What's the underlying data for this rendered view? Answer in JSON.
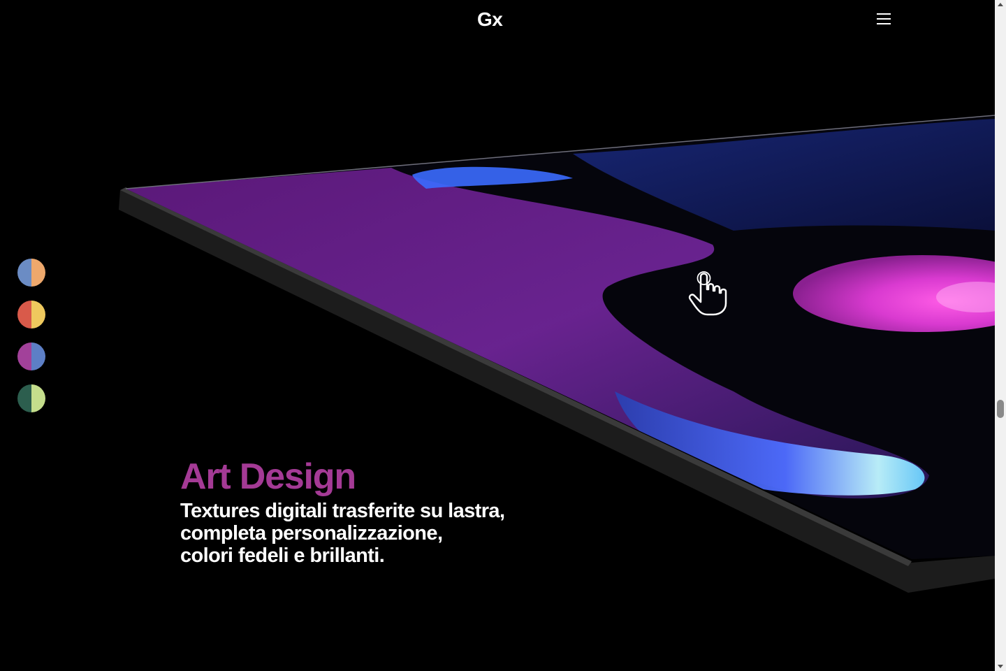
{
  "header": {
    "logo_text": "Gx",
    "menu_icon": "hamburger-menu-icon"
  },
  "swatches": [
    {
      "name": "blue-orange",
      "left_color": "#6b8cc4",
      "right_color": "#eea86c"
    },
    {
      "name": "red-yellow",
      "left_color": "#d95a4a",
      "right_color": "#efc95e"
    },
    {
      "name": "magenta-blue",
      "left_color": "#a2419a",
      "right_color": "#5d7fc6"
    },
    {
      "name": "green-lime",
      "left_color": "#2c5e4e",
      "right_color": "#c5de8c"
    }
  ],
  "hero": {
    "title": "Art Design",
    "title_color": "#a43a95",
    "subtitle_lines": [
      "Textures digitali trasferite su lastra,",
      "completa personalizzazione,",
      "colori fedeli e brillanti."
    ],
    "cursor_icon": "hand-pointer-icon"
  },
  "scrollbar": {
    "position_fraction": 0.6
  }
}
